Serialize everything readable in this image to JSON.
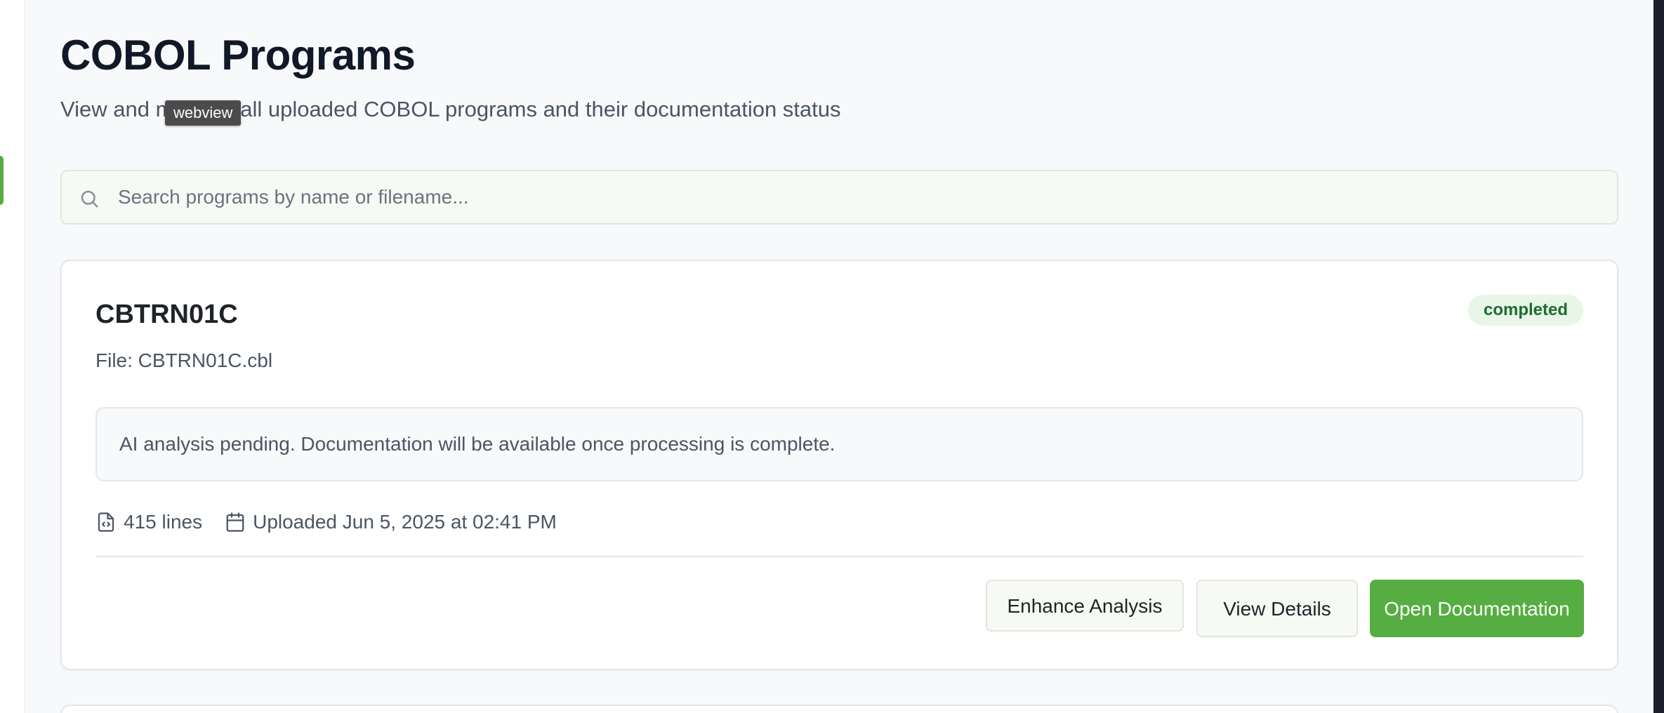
{
  "page": {
    "title": "COBOL Programs",
    "subtitle": "View and manage all uploaded COBOL programs and their documentation status"
  },
  "tooltip": {
    "text": "webview"
  },
  "search": {
    "placeholder": "Search programs by name or filename...",
    "value": "",
    "icon": "search-icon"
  },
  "programs": [
    {
      "name": "CBTRN01C",
      "file_line": "File: CBTRN01C.cbl",
      "status": "completed",
      "notice": "AI analysis pending. Documentation will be available once processing is complete.",
      "lines_text": "415 lines",
      "uploaded_text": "Uploaded Jun 5, 2025 at 02:41 PM",
      "actions": {
        "enhance_label": "Enhance Analysis",
        "details_label": "View Details",
        "open_label": "Open Documentation"
      }
    }
  ],
  "colors": {
    "accent": "#56ad41",
    "status_bg": "#e7f6e7",
    "status_text": "#1f6b32",
    "title": "#111827",
    "muted": "#4b5563"
  }
}
